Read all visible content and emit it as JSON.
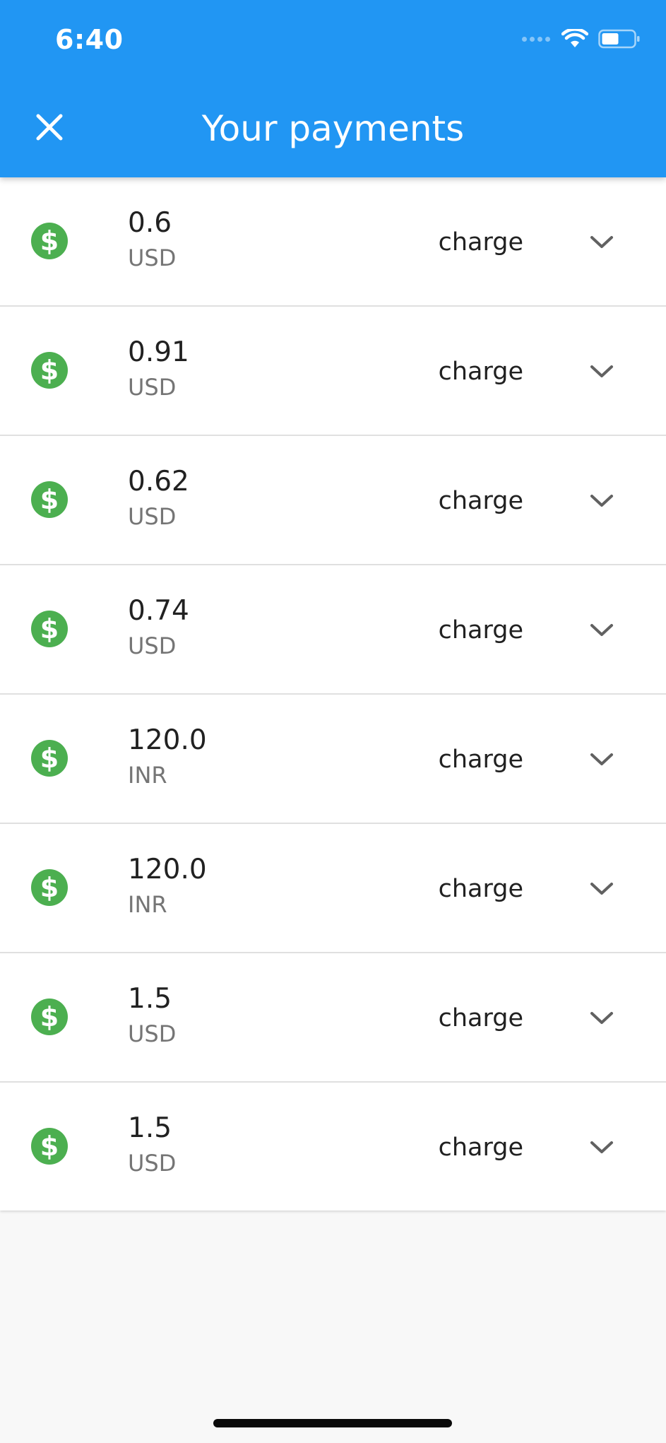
{
  "status_bar": {
    "time": "6:40"
  },
  "app_bar": {
    "title": "Your payments"
  },
  "colors": {
    "primary": "#2196f3",
    "success": "#4caf50"
  },
  "icons": {
    "close": "close-icon",
    "payment": "dollar-circle-icon",
    "expand": "chevron-down-icon"
  },
  "payments": [
    {
      "amount": "0.6",
      "currency": "USD",
      "type": "charge"
    },
    {
      "amount": "0.91",
      "currency": "USD",
      "type": "charge"
    },
    {
      "amount": "0.62",
      "currency": "USD",
      "type": "charge"
    },
    {
      "amount": "0.74",
      "currency": "USD",
      "type": "charge"
    },
    {
      "amount": "120.0",
      "currency": "INR",
      "type": "charge"
    },
    {
      "amount": "120.0",
      "currency": "INR",
      "type": "charge"
    },
    {
      "amount": "1.5",
      "currency": "USD",
      "type": "charge"
    },
    {
      "amount": "1.5",
      "currency": "USD",
      "type": "charge"
    }
  ]
}
